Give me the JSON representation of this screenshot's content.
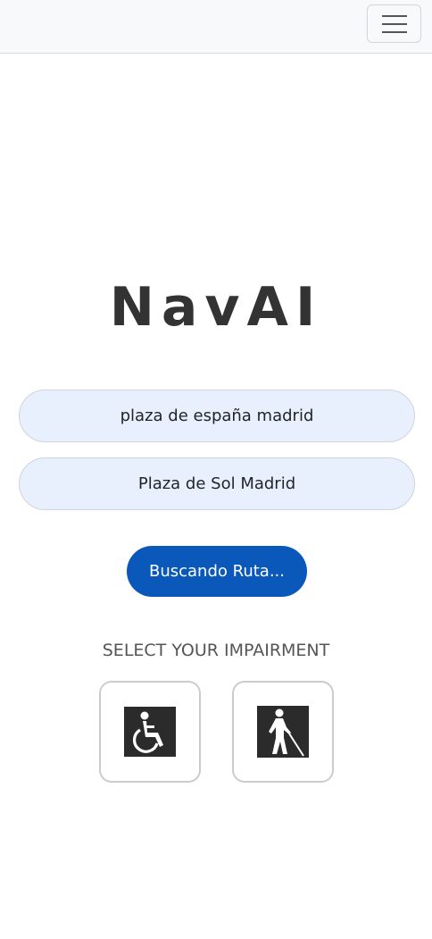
{
  "navbar": {
    "toggler_icon": "hamburger-menu-icon",
    "toggler_aria": "Toggle navigation"
  },
  "app": {
    "title": "NavAI"
  },
  "route": {
    "origin_value": "plaza de españa madrid",
    "destination_value": "Plaza de Sol Madrid",
    "search_button_label": "Buscando Ruta..."
  },
  "impairment": {
    "label": "SELECT YOUR IMPAIRMENT",
    "options": [
      {
        "icon": "wheelchair-icon"
      },
      {
        "icon": "blind-person-cane-icon"
      }
    ]
  },
  "colors": {
    "primary": "#0a58ba",
    "field_background": "#e8f0fe",
    "navbar_background": "#f8f9fa",
    "title": "#333333",
    "icon_tile": "#2b2b2b"
  }
}
